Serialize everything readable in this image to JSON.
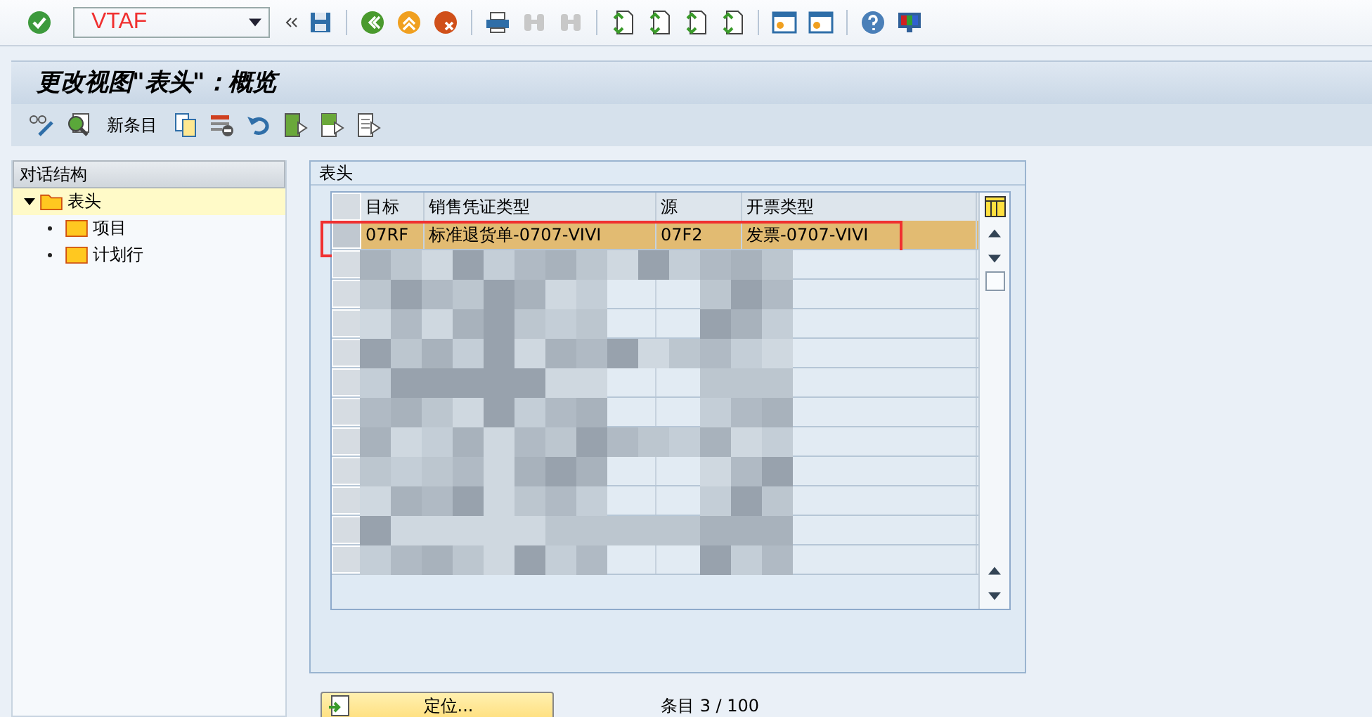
{
  "command_field": {
    "value": "VTAF"
  },
  "title": "更改视图\"表头\"：概览",
  "new_entries_button": "新条目",
  "dialog_structure": {
    "title": "对话结构",
    "items": [
      {
        "label": "表头",
        "selected": true,
        "expanded": true,
        "children": [
          {
            "label": "项目",
            "selected": false
          },
          {
            "label": "计划行",
            "selected": false
          }
        ]
      }
    ]
  },
  "table": {
    "title": "表头",
    "columns": [
      "目标",
      "销售凭证类型",
      "源",
      "开票类型"
    ],
    "rows": [
      {
        "kind": "data",
        "cells": [
          "07RF",
          "标准退货单-0707-VIVI",
          "07F2",
          "发票-0707-VIVI"
        ],
        "selected": true,
        "outlined": true
      },
      {
        "kind": "redacted",
        "selected": false
      },
      {
        "kind": "redacted",
        "selected": false
      },
      {
        "kind": "redacted",
        "selected": false
      },
      {
        "kind": "redacted",
        "selected": false
      },
      {
        "kind": "redacted",
        "selected": false
      },
      {
        "kind": "redacted",
        "selected": false
      },
      {
        "kind": "redacted",
        "selected": false
      },
      {
        "kind": "redacted",
        "selected": false
      },
      {
        "kind": "redacted",
        "selected": false
      },
      {
        "kind": "redacted",
        "selected": false
      },
      {
        "kind": "redacted",
        "selected": false
      }
    ]
  },
  "position_button": "定位...",
  "entry_count": "条目 3 / 100"
}
